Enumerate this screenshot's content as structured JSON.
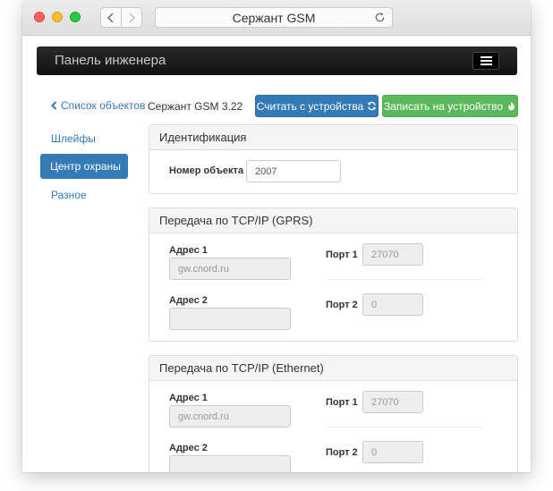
{
  "browser": {
    "title": "Сержант GSM"
  },
  "app": {
    "brand": "Панель инженера"
  },
  "sidebar": {
    "back_label": "Список объектов",
    "items": [
      {
        "label": "Шлейфы"
      },
      {
        "label": "Центр охраны"
      },
      {
        "label": "Разное"
      }
    ]
  },
  "toolbar": {
    "device_label": "Сержант GSM 3.22",
    "read_label": "Считать с устройства",
    "write_label": "Записать на устройство"
  },
  "identification": {
    "heading": "Идентификация",
    "object_number_label": "Номер объекта",
    "object_number_value": "2007"
  },
  "gprs": {
    "heading": "Передача по TCP/IP (GPRS)",
    "address1_label": "Адрес 1",
    "address1_placeholder": "gw.cnord.ru",
    "port1_label": "Порт 1",
    "port1_placeholder": "27070",
    "address2_label": "Адрес 2",
    "address2_placeholder": "",
    "port2_label": "Порт 2",
    "port2_placeholder": "0"
  },
  "ethernet": {
    "heading": "Передача по TCP/IP (Ethernet)",
    "address1_label": "Адрес 1",
    "address1_placeholder": "gw.cnord.ru",
    "port1_label": "Порт 1",
    "port1_placeholder": "27070",
    "address2_label": "Адрес 2",
    "address2_placeholder": "",
    "port2_label": "Порт 2",
    "port2_placeholder": "0"
  },
  "icons": {
    "back": "chevron-left-icon",
    "forward": "chevron-right-icon",
    "reload": "reload-icon",
    "menu": "hamburger-icon",
    "read": "refresh-icon",
    "write": "flame-icon"
  },
  "colors": {
    "primary": "#337ab7",
    "success": "#5cb85c",
    "navbar": "#1a1a1a"
  }
}
